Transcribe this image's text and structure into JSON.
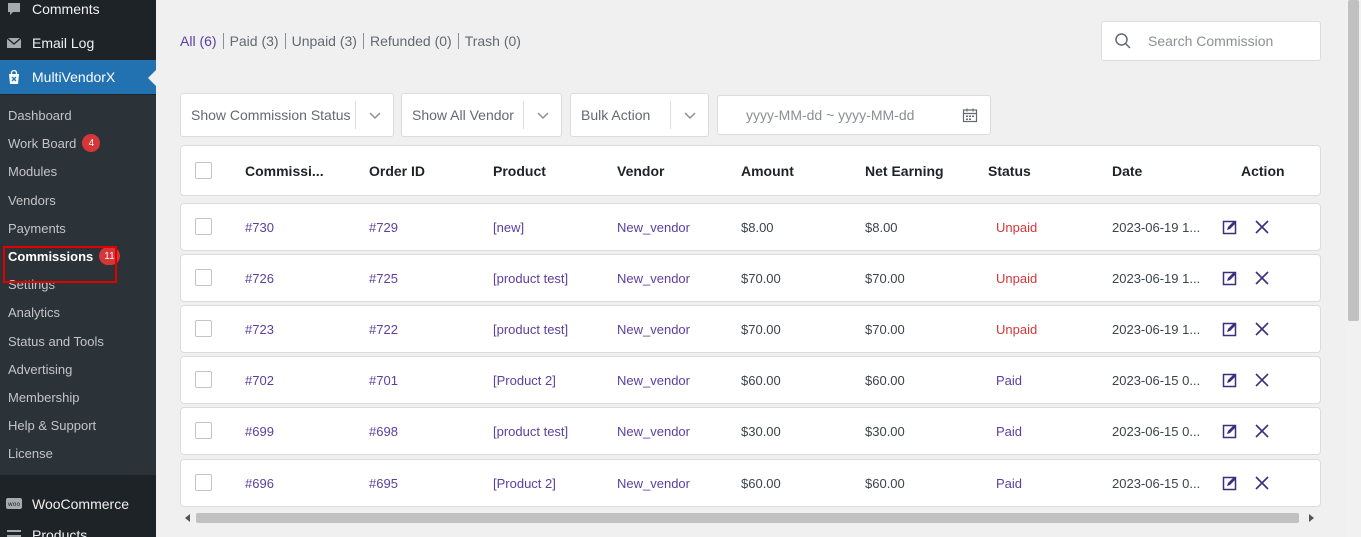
{
  "sidebar": {
    "top_items": [
      {
        "label": "Comments",
        "icon": "comment-icon"
      },
      {
        "label": "Email Log",
        "icon": "email-icon"
      },
      {
        "label": "MultiVendorX",
        "icon": "multivendorx-bag-icon"
      }
    ],
    "submenu": [
      {
        "label": "Dashboard"
      },
      {
        "label": "Work Board",
        "badge": "4"
      },
      {
        "label": "Modules"
      },
      {
        "label": "Vendors"
      },
      {
        "label": "Payments"
      },
      {
        "label": "Commissions",
        "badge": "11",
        "active": true
      },
      {
        "label": "Settings"
      },
      {
        "label": "Analytics"
      },
      {
        "label": "Status and Tools"
      },
      {
        "label": "Advertising"
      },
      {
        "label": "Membership"
      },
      {
        "label": "Help & Support"
      },
      {
        "label": "License"
      }
    ],
    "bottom_items": [
      {
        "label": "WooCommerce",
        "icon": "woocommerce-icon"
      },
      {
        "label": "Products",
        "icon": "products-icon"
      }
    ]
  },
  "status_links": [
    {
      "label": "All (6)",
      "current": true
    },
    {
      "label": "Paid (3)"
    },
    {
      "label": "Unpaid (3)"
    },
    {
      "label": "Refunded (0)"
    },
    {
      "label": "Trash (0)"
    }
  ],
  "search": {
    "placeholder": "Search Commission"
  },
  "filters": {
    "status_label": "Show Commission Status",
    "vendor_label": "Show All Vendor",
    "bulk_label": "Bulk Action",
    "date_placeholder": "yyyy-MM-dd ~ yyyy-MM-dd"
  },
  "table": {
    "columns": [
      "Commissi...",
      "Order ID",
      "Product",
      "Vendor",
      "Amount",
      "Net Earning",
      "Status",
      "Date",
      "Action"
    ],
    "rows": [
      {
        "commission": "#730",
        "order": "#729",
        "product": "[new]",
        "vendor": "New_vendor",
        "amount": "$8.00",
        "net": "$8.00",
        "status": "Unpaid",
        "date": "2023-06-19 1..."
      },
      {
        "commission": "#726",
        "order": "#725",
        "product": "[product test]",
        "vendor": "New_vendor",
        "amount": "$70.00",
        "net": "$70.00",
        "status": "Unpaid",
        "date": "2023-06-19 1..."
      },
      {
        "commission": "#723",
        "order": "#722",
        "product": "[product test]",
        "vendor": "New_vendor",
        "amount": "$70.00",
        "net": "$70.00",
        "status": "Unpaid",
        "date": "2023-06-19 1..."
      },
      {
        "commission": "#702",
        "order": "#701",
        "product": "[Product 2]",
        "vendor": "New_vendor",
        "amount": "$60.00",
        "net": "$60.00",
        "status": "Paid",
        "date": "2023-06-15 0..."
      },
      {
        "commission": "#699",
        "order": "#698",
        "product": "[product test]",
        "vendor": "New_vendor",
        "amount": "$30.00",
        "net": "$30.00",
        "status": "Paid",
        "date": "2023-06-15 0..."
      },
      {
        "commission": "#696",
        "order": "#695",
        "product": "[Product 2]",
        "vendor": "New_vendor",
        "amount": "$60.00",
        "net": "$60.00",
        "status": "Paid",
        "date": "2023-06-15 0..."
      }
    ]
  },
  "colors": {
    "accent": "#5b3f9f",
    "unpaid": "#d63638",
    "sidebar_active": "#2271b1",
    "highlight": "#e00000"
  }
}
